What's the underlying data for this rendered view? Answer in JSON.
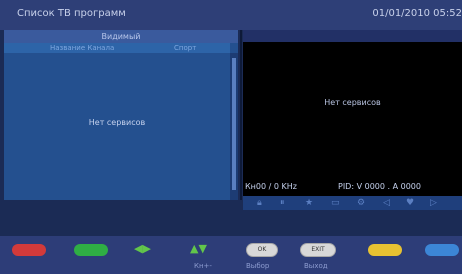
{
  "header": {
    "title": "Список ТВ программ",
    "datetime": "01/01/2010 05:52"
  },
  "left_panel": {
    "header": "Видимый",
    "columns": [
      "",
      "Название Канала",
      "Спорт"
    ],
    "empty_text": "Нет сервисов"
  },
  "right_panel": {
    "empty_text": "Нет сервисов",
    "frequency": "Кн00 / 0 KHz",
    "pid": "PID: V 0000 . A 0000"
  },
  "footer": {
    "ok": "OK",
    "exit": "EXIT",
    "labels": [
      "Кн+-",
      "Выбор",
      "Выход"
    ],
    "colors": {
      "red": "#d23a3a",
      "green": "#2fae44",
      "yellow": "#e7c232",
      "blue": "#3c86d6"
    }
  },
  "icons": {
    "lr_arrows": "◀▶",
    "ud_arrows": "▲▼",
    "strip": [
      "lock-icon",
      "pause-icon",
      "favorite-icon",
      "tv-icon",
      "gear-icon",
      "rewind-icon",
      "heart-icon",
      "play-icon"
    ]
  }
}
